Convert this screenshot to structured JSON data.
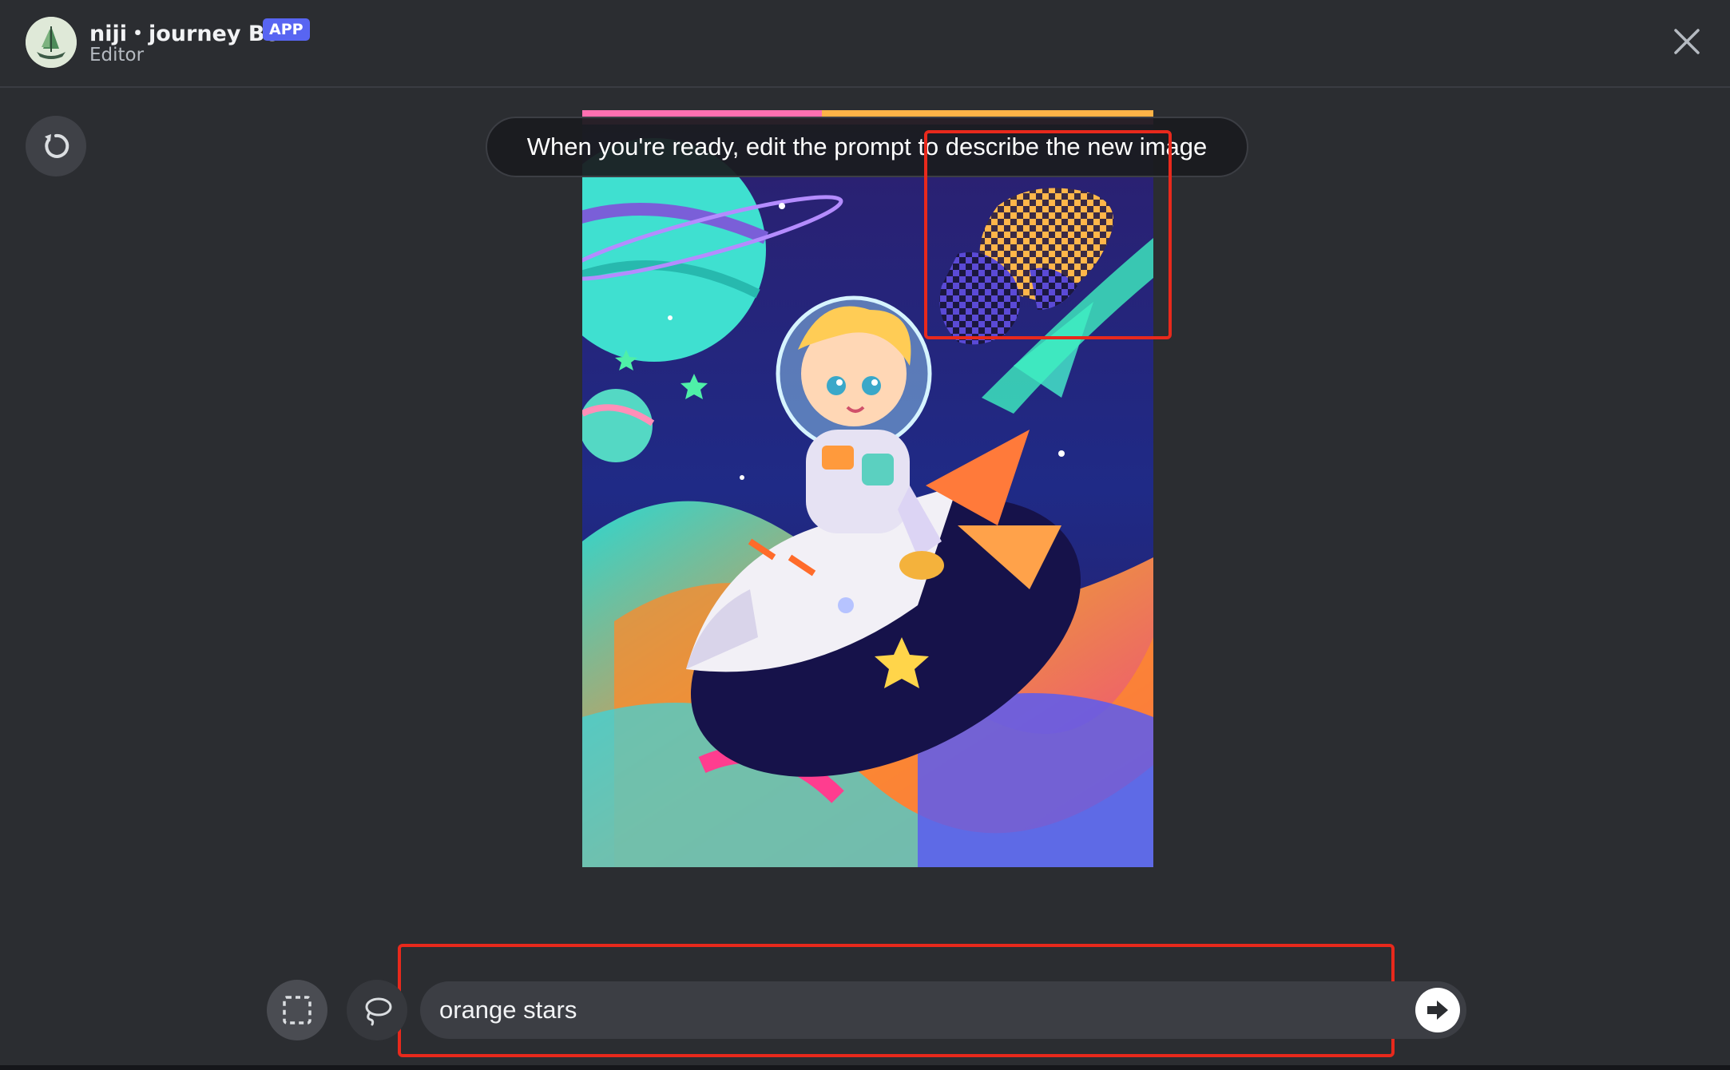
{
  "header": {
    "bot_name": "niji・journey Bot",
    "badge": "APP",
    "subtitle": "Editor",
    "avatar_icon": "sailboat-avatar",
    "close_icon": "close-icon"
  },
  "toolbar": {
    "undo_icon": "undo-icon"
  },
  "tooltip": {
    "text": "When you're ready, edit the prompt to describe the new image"
  },
  "canvas": {
    "description_icon": "astronaut-rocket-artwork",
    "erased_region": "checkerboard-transparency"
  },
  "tools": {
    "rect_select_icon": "rect-select-icon",
    "lasso_icon": "lasso-icon"
  },
  "prompt": {
    "value": "orange stars",
    "submit_icon": "arrow-right-icon"
  },
  "colors": {
    "background": "#2b2d31",
    "badge": "#5865f2",
    "annotation": "#e8291c"
  }
}
